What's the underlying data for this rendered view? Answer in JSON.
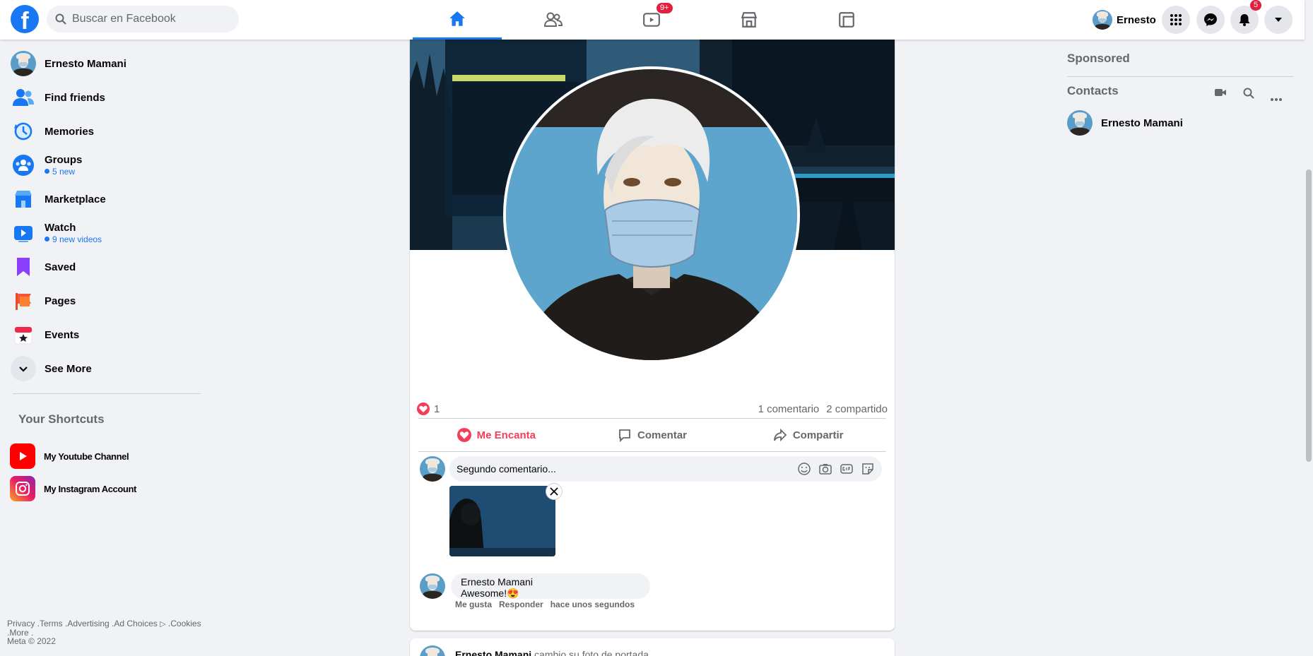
{
  "topbar": {
    "logo": "f",
    "search_placeholder": "Buscar en Facebook",
    "watch_badge": "9+",
    "notifications_badge": "5",
    "profile_name": "Ernesto"
  },
  "sidebar": {
    "items": [
      {
        "label": "Ernesto Mamani",
        "icon": "avatar"
      },
      {
        "label": "Find friends",
        "icon": "friends-icon"
      },
      {
        "label": "Memories",
        "icon": "clock-icon"
      },
      {
        "label": "Groups",
        "sub": "5 new",
        "icon": "groups-icon"
      },
      {
        "label": "Marketplace",
        "icon": "marketplace-icon"
      },
      {
        "label": "Watch",
        "sub": "9 new videos",
        "icon": "watch-icon"
      },
      {
        "label": "Saved",
        "icon": "bookmark-icon"
      },
      {
        "label": "Pages",
        "icon": "flag-icon"
      },
      {
        "label": "Events",
        "icon": "calendar-icon"
      },
      {
        "label": "See More",
        "icon": "chevron-down-icon"
      }
    ],
    "shortcuts_title": "Your Shortcuts",
    "shortcuts": [
      {
        "label": "My Youtube Channel",
        "icon": "youtube-icon"
      },
      {
        "label": "My Instagram Account",
        "icon": "instagram-icon"
      }
    ],
    "footer": {
      "line1": "Privacy .Terms .Advertising .Ad Choices",
      "cookies": " .Cookies",
      "line2": ".More .",
      "line3": "Meta © 2022"
    }
  },
  "post": {
    "reactions_count": "1",
    "comments_count": "1 comentario",
    "shares_count": "2 compartido",
    "actions": {
      "love": "Me Encanta",
      "comment": "Comentar",
      "share": "Compartir"
    },
    "comment_input_value": "Segundo comentario...",
    "comment": {
      "author": "Ernesto Mamani",
      "text": "Awesome!😍",
      "like": "Me gusta",
      "reply": "Responder",
      "time": "hace unos segundos"
    }
  },
  "post2": {
    "author": "Ernesto Mamani",
    "action": " cambio su foto de portada"
  },
  "rightcol": {
    "sponsored": "Sponsored",
    "contacts": "Contacts",
    "contact_name": "Ernesto Mamani"
  },
  "colors": {
    "brand": "#1877f2",
    "love": "#f33e58",
    "badge": "#e41e3f"
  }
}
